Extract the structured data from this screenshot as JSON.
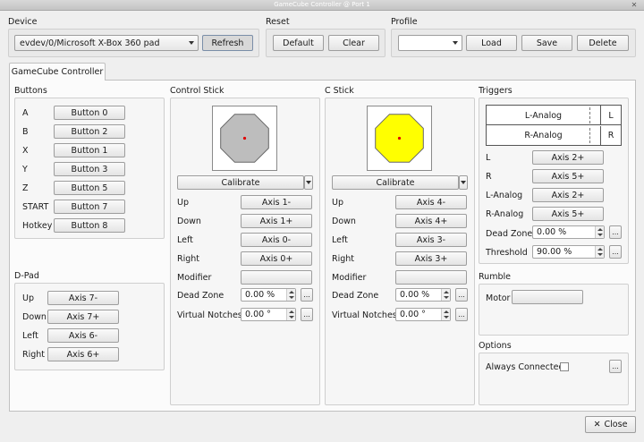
{
  "window": {
    "title": "GameCube Controller @ Port 1"
  },
  "device": {
    "label": "Device",
    "selected": "evdev/0/Microsoft X-Box 360 pad",
    "refresh": "Refresh"
  },
  "reset": {
    "label": "Reset",
    "default": "Default",
    "clear": "Clear"
  },
  "profile": {
    "label": "Profile",
    "selected": "",
    "load": "Load",
    "save": "Save",
    "delete": "Delete"
  },
  "tab": {
    "label": "GameCube Controller"
  },
  "buttons": {
    "title": "Buttons",
    "rows": [
      {
        "name": "A",
        "value": "Button 0"
      },
      {
        "name": "B",
        "value": "Button 2"
      },
      {
        "name": "X",
        "value": "Button 1"
      },
      {
        "name": "Y",
        "value": "Button 3"
      },
      {
        "name": "Z",
        "value": "Button 5"
      },
      {
        "name": "START",
        "value": "Button 7"
      },
      {
        "name": "Hotkey",
        "value": "Button 8"
      }
    ]
  },
  "dpad": {
    "title": "D-Pad",
    "rows": [
      {
        "name": "Up",
        "value": "Axis 7-"
      },
      {
        "name": "Down",
        "value": "Axis 7+"
      },
      {
        "name": "Left",
        "value": "Axis 6-"
      },
      {
        "name": "Right",
        "value": "Axis 6+"
      }
    ]
  },
  "control_stick": {
    "title": "Control Stick",
    "calibrate": "Calibrate",
    "rows": [
      {
        "name": "Up",
        "value": "Axis 1-"
      },
      {
        "name": "Down",
        "value": "Axis 1+"
      },
      {
        "name": "Left",
        "value": "Axis 0-"
      },
      {
        "name": "Right",
        "value": "Axis 0+"
      },
      {
        "name": "Modifier",
        "value": ""
      }
    ],
    "dead_zone": {
      "label": "Dead Zone",
      "value": "0.00 %"
    },
    "notches": {
      "label": "Virtual Notches",
      "value": "0.00 °"
    },
    "fill_color": "#bdbdbd"
  },
  "c_stick": {
    "title": "C Stick",
    "calibrate": "Calibrate",
    "rows": [
      {
        "name": "Up",
        "value": "Axis 4-"
      },
      {
        "name": "Down",
        "value": "Axis 4+"
      },
      {
        "name": "Left",
        "value": "Axis 3-"
      },
      {
        "name": "Right",
        "value": "Axis 3+"
      },
      {
        "name": "Modifier",
        "value": ""
      }
    ],
    "dead_zone": {
      "label": "Dead Zone",
      "value": "0.00 %"
    },
    "notches": {
      "label": "Virtual Notches",
      "value": "0.00 °"
    },
    "fill_color": "#ffff00"
  },
  "triggers": {
    "title": "Triggers",
    "table": [
      {
        "name": "L-Analog",
        "key": "L"
      },
      {
        "name": "R-Analog",
        "key": "R"
      }
    ],
    "rows": [
      {
        "name": "L",
        "value": "Axis 2+"
      },
      {
        "name": "R",
        "value": "Axis 5+"
      },
      {
        "name": "L-Analog",
        "value": "Axis 2+"
      },
      {
        "name": "R-Analog",
        "value": "Axis 5+"
      }
    ],
    "dead_zone": {
      "label": "Dead Zone",
      "value": "0.00 %"
    },
    "threshold": {
      "label": "Threshold",
      "value": "90.00 %"
    }
  },
  "rumble": {
    "title": "Rumble",
    "motor_label": "Motor",
    "motor_value": ""
  },
  "options": {
    "title": "Options",
    "always_connected": "Always Connected"
  },
  "more_glyph": "...",
  "close": {
    "label": "Close",
    "glyph": "✕"
  },
  "colors": {
    "stick_dot": "#e00000",
    "accent_border": "#7a8ea8"
  }
}
